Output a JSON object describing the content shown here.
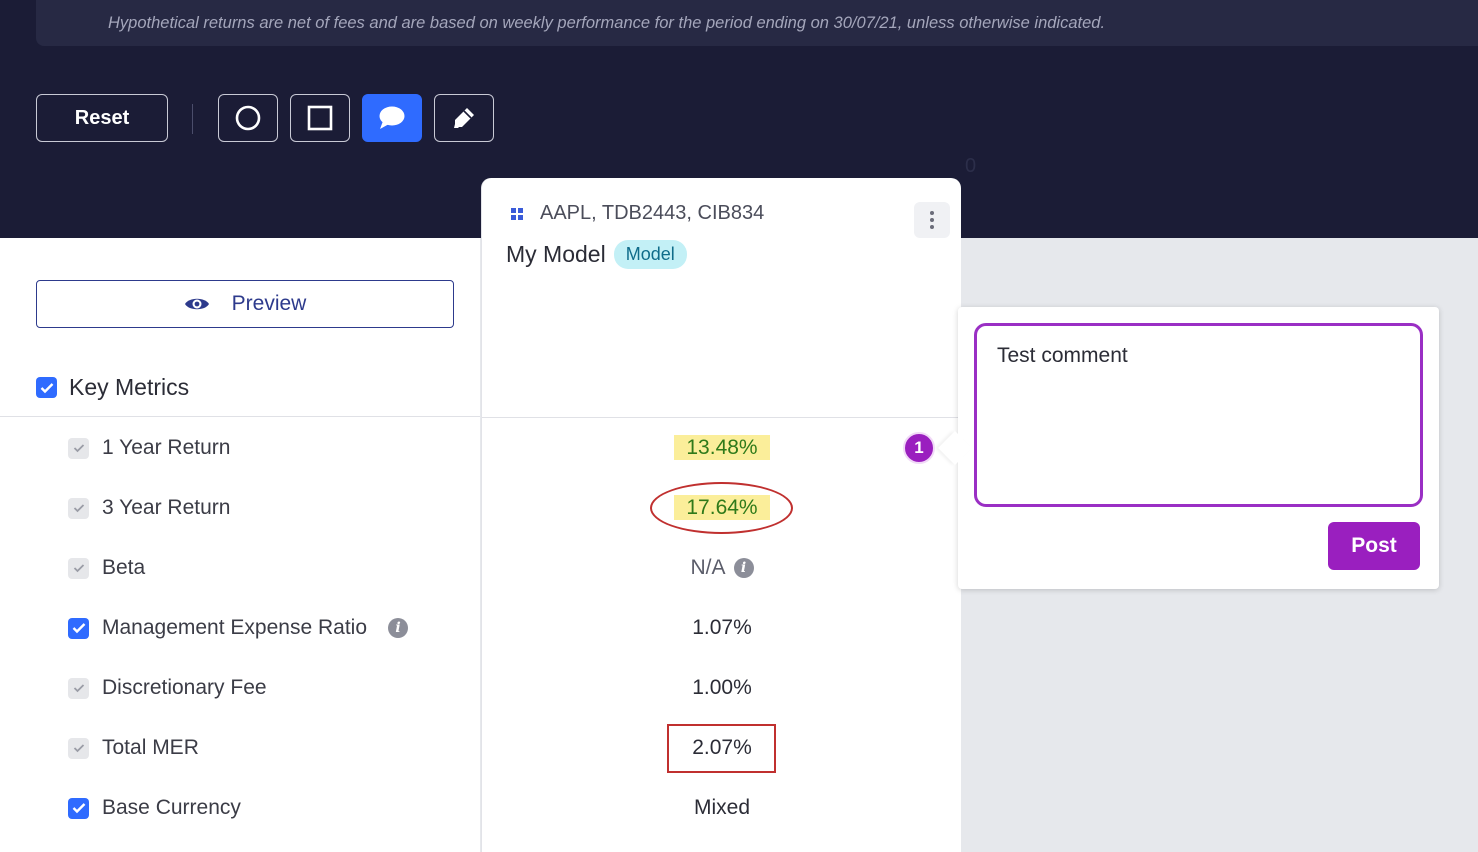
{
  "header": {
    "disclaimer": "Hypothetical returns are net of fees and are based on weekly performance for the period ending on 30/07/21, unless otherwise indicated.",
    "reset_label": "Reset",
    "stray_text": "0",
    "tools": [
      {
        "name": "circle-tool",
        "icon": "circle-outline-icon",
        "active": false
      },
      {
        "name": "rectangle-tool",
        "icon": "square-outline-icon",
        "active": false
      },
      {
        "name": "comment-tool",
        "icon": "speech-bubble-icon",
        "active": true
      },
      {
        "name": "highlighter-tool",
        "icon": "highlighter-pen-icon",
        "active": false
      }
    ]
  },
  "sidebar": {
    "preview_label": "Preview",
    "section_label": "Key Metrics",
    "metrics": [
      {
        "label": "1 Year Return",
        "checked": false
      },
      {
        "label": "3 Year Return",
        "checked": false
      },
      {
        "label": "Beta",
        "checked": false
      },
      {
        "label": "Management Expense Ratio",
        "checked": true,
        "info": true
      },
      {
        "label": "Discretionary Fee",
        "checked": false
      },
      {
        "label": "Total MER",
        "checked": false
      },
      {
        "label": "Base Currency",
        "checked": true
      }
    ]
  },
  "card": {
    "tickers": "AAPL, TDB2443, CIB834",
    "title": "My Model",
    "badge": "Model",
    "values": [
      "13.48%",
      "17.64%",
      "N/A",
      "1.07%",
      "1.00%",
      "2.07%",
      "Mixed"
    ]
  },
  "comment": {
    "marker": "1",
    "text": "Test comment",
    "post_label": "Post"
  },
  "colors": {
    "header_bg": "#1b1c36",
    "accent_blue": "#2f6bff",
    "comment_purple": "#9a1fbf",
    "annotation_red": "#c0302f",
    "highlight_yellow": "#fbee9a"
  }
}
